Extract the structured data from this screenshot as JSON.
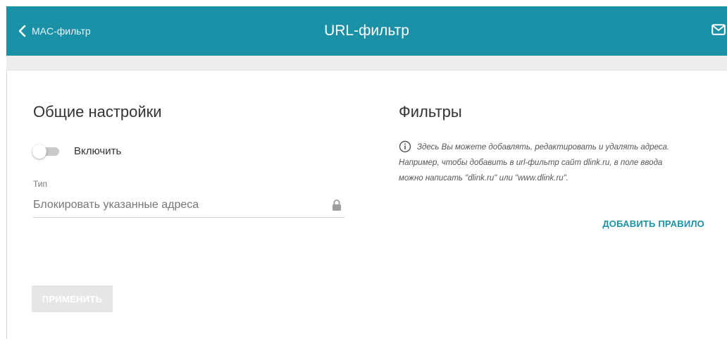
{
  "header": {
    "back_label": "MAC-фильтр",
    "title": "URL-фильтр",
    "icons": {
      "back": "chevron-left-icon",
      "mail": "mail-icon"
    },
    "color": "#1b91a8"
  },
  "general": {
    "title": "Общие настройки",
    "enable_label": "Включить",
    "enable_on": false,
    "type_label": "Тип",
    "type_value": "Блокировать указанные адреса",
    "lock_icon": "lock-icon",
    "apply_label": "ПРИМЕНИТЬ"
  },
  "filters": {
    "title": "Фильтры",
    "info_lines": [
      "Здесь Вы можете добавлять, редактировать и удалять адреса.",
      "Например, чтобы добавить в url-фильтр сайт dlink.ru, в поле ввода",
      "можно написать \"dlink.ru\" или \"www.dlink.ru\"."
    ],
    "info_icon": "info-icon",
    "add_rule_label": "ДОБАВИТЬ ПРАВИЛО"
  }
}
